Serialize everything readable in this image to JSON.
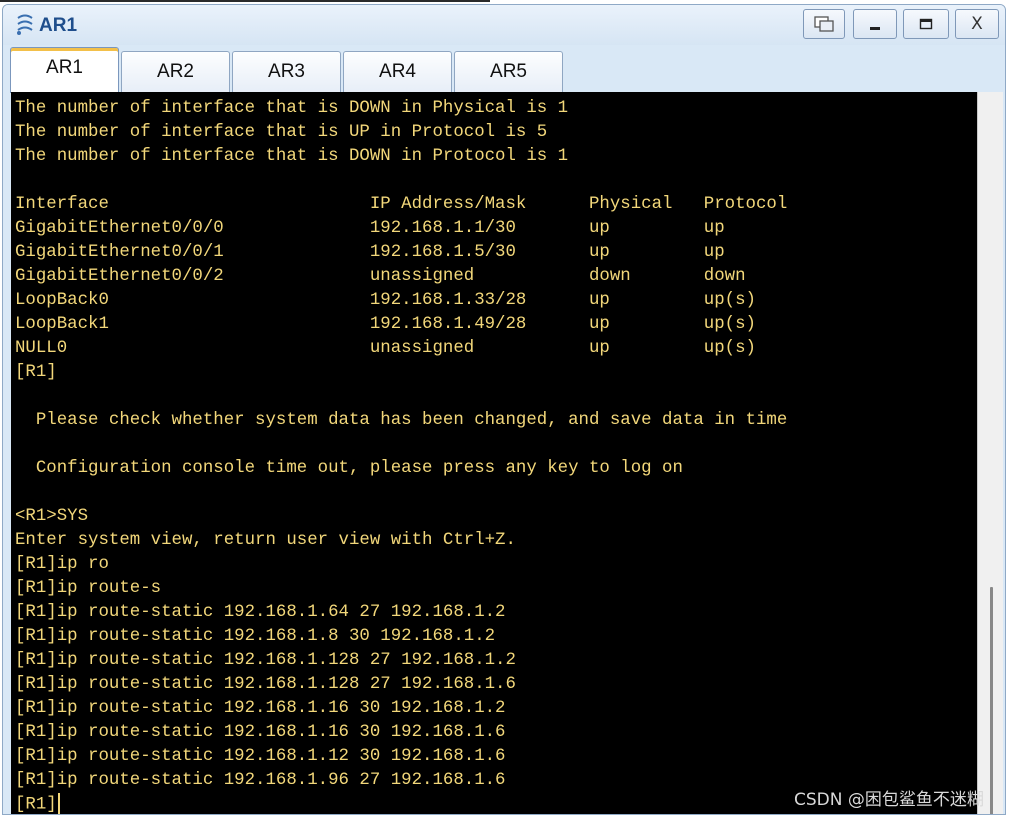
{
  "window": {
    "title": "AR1",
    "icon": "huawei-router-icon",
    "controls": {
      "restore": "restore-icon",
      "minimize": "minimize-icon",
      "maximize": "maximize-icon",
      "close_label": "X"
    }
  },
  "tabs": [
    {
      "label": "AR1",
      "active": true
    },
    {
      "label": "AR2",
      "active": false
    },
    {
      "label": "AR3",
      "active": false
    },
    {
      "label": "AR4",
      "active": false
    },
    {
      "label": "AR5",
      "active": false
    }
  ],
  "terminal": {
    "lines": [
      "The number of interface that is DOWN in Physical is 1",
      "The number of interface that is UP in Protocol is 5",
      "The number of interface that is DOWN in Protocol is 1",
      "",
      "Interface                         IP Address/Mask      Physical   Protocol",
      "GigabitEthernet0/0/0              192.168.1.1/30       up         up",
      "GigabitEthernet0/0/1              192.168.1.5/30       up         up",
      "GigabitEthernet0/0/2              unassigned           down       down",
      "LoopBack0                         192.168.1.33/28      up         up(s)",
      "LoopBack1                         192.168.1.49/28      up         up(s)",
      "NULL0                             unassigned           up         up(s)",
      "[R1]",
      "",
      "  Please check whether system data has been changed, and save data in time",
      "",
      "  Configuration console time out, please press any key to log on",
      "",
      "<R1>SYS",
      "Enter system view, return user view with Ctrl+Z.",
      "[R1]ip ro",
      "[R1]ip route-s",
      "[R1]ip route-static 192.168.1.64 27 192.168.1.2",
      "[R1]ip route-static 192.168.1.8 30 192.168.1.2",
      "[R1]ip route-static 192.168.1.128 27 192.168.1.2",
      "[R1]ip route-static 192.168.1.128 27 192.168.1.6",
      "[R1]ip route-static 192.168.1.16 30 192.168.1.2",
      "[R1]ip route-static 192.168.1.16 30 192.168.1.6",
      "[R1]ip route-static 192.168.1.12 30 192.168.1.6",
      "[R1]ip route-static 192.168.1.96 27 192.168.1.6",
      "[R1]"
    ],
    "text_color": "#f2d77a",
    "background": "#000000"
  },
  "watermark": "CSDN @困包鲨鱼不迷糊"
}
